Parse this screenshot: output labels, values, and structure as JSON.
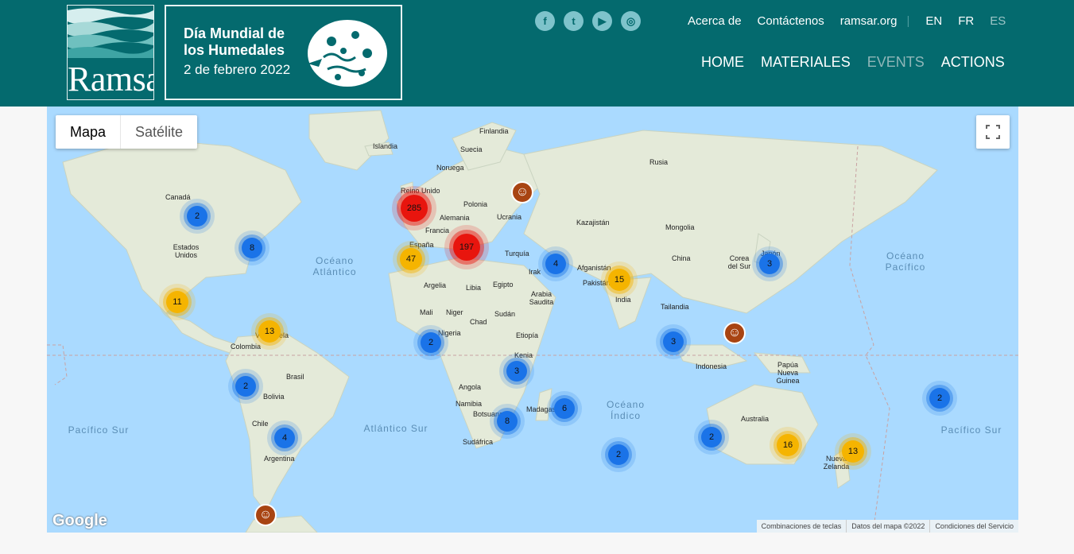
{
  "header": {
    "logo_text": "Ramsar",
    "event_title": "Día Mundial de los Humedales",
    "event_date": "2 de febrero 2022",
    "social": [
      {
        "name": "facebook-icon",
        "glyph": "f"
      },
      {
        "name": "twitter-icon",
        "glyph": "t"
      },
      {
        "name": "youtube-icon",
        "glyph": "▶"
      },
      {
        "name": "instagram-icon",
        "glyph": "◎"
      }
    ],
    "top_links": [
      "Acerca de",
      "Contáctenos",
      "ramsar.org"
    ],
    "languages": [
      "EN",
      "FR",
      "ES"
    ],
    "nav": [
      "HOME",
      "MATERIALES",
      "EVENTS",
      "ACTIONS"
    ]
  },
  "map": {
    "type_options": [
      "Mapa",
      "Satélite"
    ],
    "clusters": [
      {
        "count": "2",
        "color": "blue"
      },
      {
        "count": "8",
        "color": "blue"
      },
      {
        "count": "11",
        "color": "yellow"
      },
      {
        "count": "13",
        "color": "yellow"
      },
      {
        "count": "2",
        "color": "blue"
      },
      {
        "count": "4",
        "color": "blue"
      },
      {
        "count": "285",
        "color": "red"
      },
      {
        "count": "47",
        "color": "yellow"
      },
      {
        "count": "197",
        "color": "red"
      },
      {
        "count": "4",
        "color": "blue"
      },
      {
        "count": "15",
        "color": "yellow"
      },
      {
        "count": "3",
        "color": "blue"
      },
      {
        "count": "2",
        "color": "blue"
      },
      {
        "count": "3",
        "color": "blue"
      },
      {
        "count": "3",
        "color": "blue"
      },
      {
        "count": "8",
        "color": "blue"
      },
      {
        "count": "6",
        "color": "blue"
      },
      {
        "count": "2",
        "color": "blue"
      },
      {
        "count": "2",
        "color": "blue"
      },
      {
        "count": "16",
        "color": "yellow"
      },
      {
        "count": "13",
        "color": "yellow"
      },
      {
        "count": "2",
        "color": "blue"
      }
    ],
    "place_labels": [
      "Finlandia",
      "Islandia",
      "Suecia",
      "Noruega",
      "Rusia",
      "Reino Unido",
      "Polonia",
      "Alemania",
      "Ucrania",
      "Francia",
      "Kazajistán",
      "Mongolia",
      "Canadá",
      "Estados Unidos",
      "España",
      "Turquía",
      "China",
      "Corea del Sur",
      "Japón",
      "Irak",
      "Afganistán",
      "Pakistán",
      "Argelia",
      "Libia",
      "Egipto",
      "Arabia Saudita",
      "India",
      "Tailandia",
      "Mali",
      "Niger",
      "Chad",
      "Sudán",
      "Nigeria",
      "Etiopía",
      "Kenia",
      "Indonesia",
      "Papúa Nueva Guinea",
      "Colombia",
      "Venezuela",
      "Brasil",
      "Bolivia",
      "Chile",
      "Argentina",
      "Angola",
      "Namibia",
      "Botsuana",
      "Sudáfrica",
      "Madagascar",
      "Australia",
      "Nueva Zelanda"
    ],
    "ocean_labels": [
      "Océano Atlántico",
      "Océano Pacífico",
      "Océano Índico",
      "Pacífico Sur",
      "Atlántico Sur",
      "Pacífico Sur"
    ],
    "attribution": [
      "Combinaciones de teclas",
      "Datos del mapa ©2022",
      "Condiciones del Servicio"
    ],
    "google_logo": "Google"
  },
  "colors": {
    "header_bg": "#046a6e",
    "ocean": "#aadaff",
    "land": "#e4ead9",
    "cluster_blue": "#1a73e8",
    "cluster_yellow": "#f5b400",
    "cluster_red": "#e8150e",
    "pin": "#a84412"
  }
}
